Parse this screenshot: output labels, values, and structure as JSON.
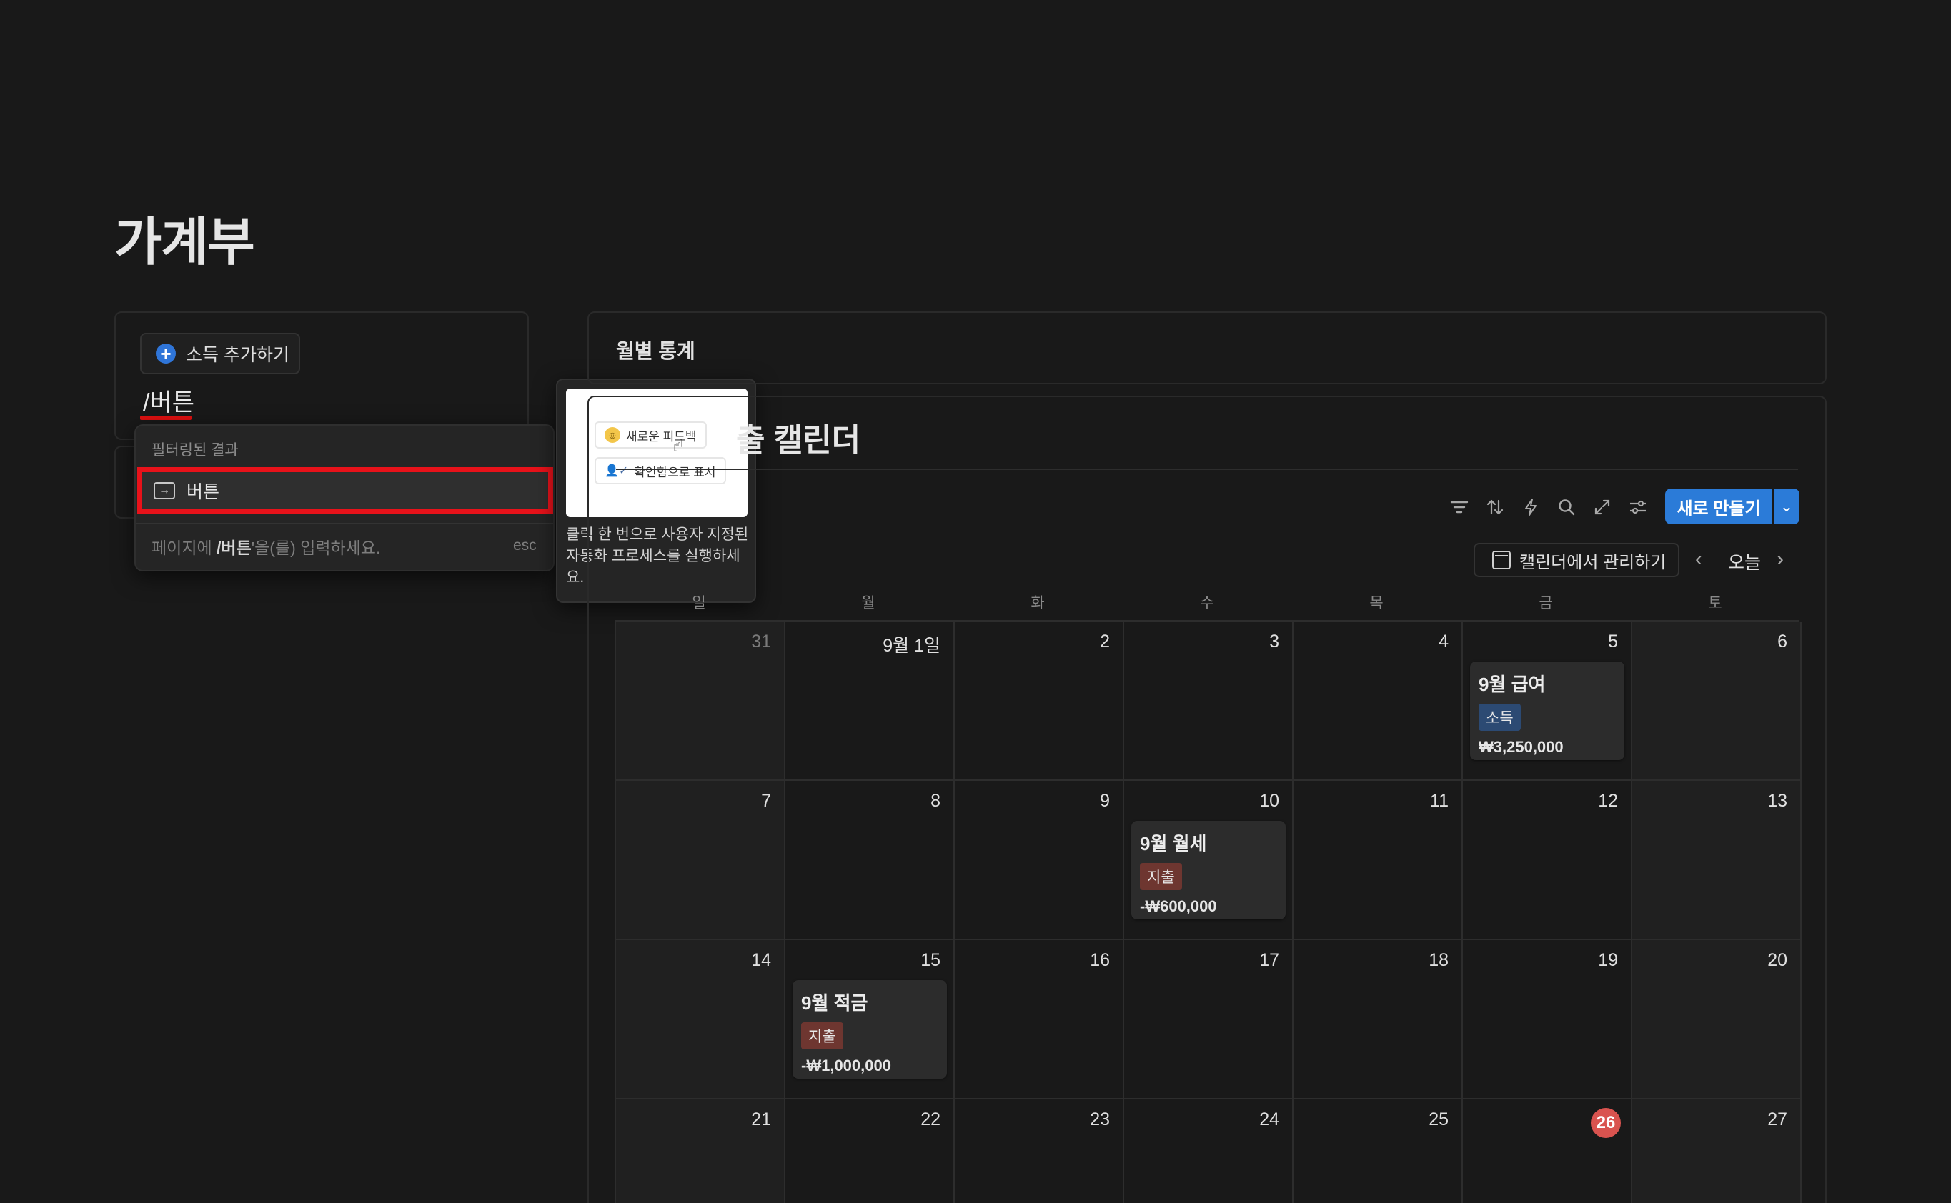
{
  "page": {
    "title": "가계부"
  },
  "left": {
    "add_income_label": "소득 추가하기",
    "slash_input": "/버튼"
  },
  "slash_menu": {
    "header": "필터링된 결과",
    "item_label": "버튼",
    "hint_prefix": "페이지에 ",
    "hint_bold": "/버튼",
    "hint_suffix": "'을(를) 입력하세요.",
    "esc_label": "esc"
  },
  "preview": {
    "pill1": "새로운 피드백",
    "pill2": "확인함으로 표시",
    "description": "클릭 한 번으로 사용자 지정된 자동화 프로세스를 실행하세요."
  },
  "monthly_stats": {
    "title": "월별 통계"
  },
  "calendar": {
    "title": "출 캘린더",
    "new_button": "새로 만들기",
    "manage_button": "캘린더에서 관리하기",
    "today_label": "오늘",
    "weekdays": [
      "일",
      "월",
      "화",
      "수",
      "목",
      "금",
      "토"
    ],
    "today": "26",
    "weeks": [
      [
        "31",
        "9월 1일",
        "2",
        "3",
        "4",
        "5",
        "6"
      ],
      [
        "7",
        "8",
        "9",
        "10",
        "11",
        "12",
        "13"
      ],
      [
        "14",
        "15",
        "16",
        "17",
        "18",
        "19",
        "20"
      ],
      [
        "21",
        "22",
        "23",
        "24",
        "25",
        "26",
        "27"
      ]
    ],
    "events": [
      {
        "title": "9월 급여",
        "tag": "소득",
        "amount": "₩3,250,000"
      },
      {
        "title": "9월 월세",
        "tag": "지출",
        "amount": "-₩600,000"
      },
      {
        "title": "9월 적금",
        "tag": "지출",
        "amount": "-₩1,000,000"
      }
    ]
  },
  "icons": {
    "filter": "filter-icon",
    "sort": "sort-icon",
    "automation": "lightning-icon",
    "search": "search-icon",
    "expand": "expand-icon",
    "settings": "sliders-icon"
  },
  "colors": {
    "background": "#191919",
    "accent": "#2b7bd8",
    "highlight": "#e8121a",
    "income_tag": "#2c4a73",
    "expense_tag": "#6e3630",
    "today": "#d9534f"
  }
}
